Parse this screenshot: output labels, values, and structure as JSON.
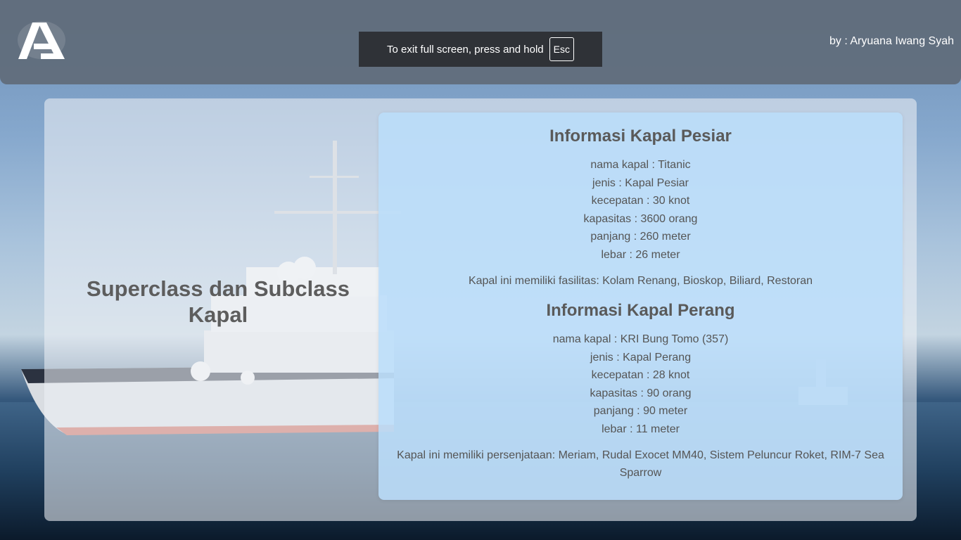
{
  "header": {
    "author": "by : Aryuana Iwang Syah",
    "logo_text": "A"
  },
  "fullscreen_notice": {
    "text": "To exit full screen, press and hold",
    "key": "Esc"
  },
  "main": {
    "title": "Superclass dan Subclass Kapal"
  },
  "sections": [
    {
      "title": "Informasi Kapal Pesiar",
      "lines": [
        "nama kapal : Titanic",
        "jenis : Kapal Pesiar",
        "kecepatan : 30 knot",
        "kapasitas : 3600 orang",
        "panjang : 260 meter",
        "lebar : 26 meter"
      ],
      "extra": "Kapal ini memiliki fasilitas: Kolam Renang, Bioskop, Biliard, Restoran"
    },
    {
      "title": "Informasi Kapal Perang",
      "lines": [
        "nama kapal : KRI Bung Tomo (357)",
        "jenis : Kapal Perang",
        "kecepatan : 28 knot",
        "kapasitas : 90 orang",
        "panjang : 90 meter",
        "lebar : 11 meter"
      ],
      "extra": "Kapal ini memiliki persenjataan: Meriam, Rudal Exocet MM40, Sistem Peluncur Roket, RIM-7 Sea Sparrow"
    }
  ],
  "colors": {
    "header_bg": "#606c7a",
    "info_panel": "#badcfa",
    "title_text": "#5d5d5d"
  }
}
